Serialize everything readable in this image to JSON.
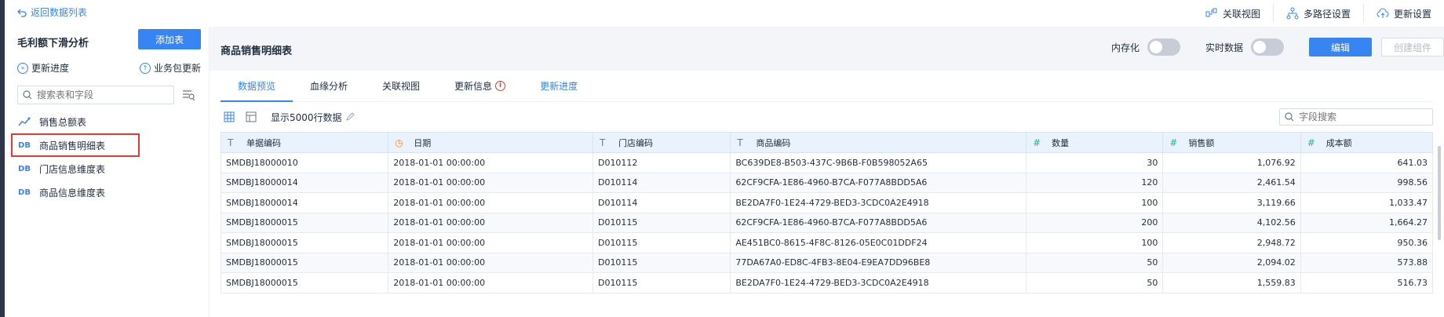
{
  "header": {
    "back_label": "返回数据列表",
    "actions": [
      {
        "label": "关联视图",
        "icon": "relation-view-icon"
      },
      {
        "label": "多路径设置",
        "icon": "multi-path-icon"
      },
      {
        "label": "更新设置",
        "icon": "cloud-update-icon"
      }
    ]
  },
  "sidebar": {
    "title": "毛利额下滑分析",
    "add_table_label": "添加表",
    "update_progress_label": "更新进度",
    "package_update_label": "业务包更新",
    "search_placeholder": "搜索表和字段",
    "items": [
      {
        "label": "销售总额表",
        "icon": "analysis-table-icon"
      },
      {
        "label": "商品销售明细表",
        "icon": "db-table-icon"
      },
      {
        "label": "门店信息维度表",
        "icon": "db-table-icon"
      },
      {
        "label": "商品信息维度表",
        "icon": "db-table-icon"
      }
    ]
  },
  "main": {
    "title": "商品销售明细表",
    "in_memory_label": "内存化",
    "realtime_label": "实时数据",
    "edit_label": "编辑",
    "create_component_label": "创建组件",
    "tabs": [
      {
        "label": "数据预览"
      },
      {
        "label": "血缘分析"
      },
      {
        "label": "关联视图"
      },
      {
        "label": "更新信息"
      },
      {
        "label": "更新进度"
      }
    ],
    "rows_label": "显示5000行数据",
    "field_search_placeholder": "字段搜索"
  },
  "table": {
    "columns": [
      {
        "label": "单据编码",
        "type": "T"
      },
      {
        "label": "日期",
        "type": "date"
      },
      {
        "label": "门店编码",
        "type": "T"
      },
      {
        "label": "商品编码",
        "type": "T"
      },
      {
        "label": "数量",
        "type": "#"
      },
      {
        "label": "销售额",
        "type": "#"
      },
      {
        "label": "成本额",
        "type": "#"
      }
    ],
    "rows": [
      [
        "SMDBJ18000010",
        "2018-01-01 00:00:00",
        "D010112",
        "BC639DE8-B503-437C-9B6B-F0B598052A65",
        "30",
        "1,076.92",
        "641.03"
      ],
      [
        "SMDBJ18000014",
        "2018-01-01 00:00:00",
        "D010114",
        "62CF9CFA-1E86-4960-B7CA-F077A8BDD5A6",
        "120",
        "2,461.54",
        "998.56"
      ],
      [
        "SMDBJ18000014",
        "2018-01-01 00:00:00",
        "D010114",
        "BE2DA7F0-1E24-4729-BED3-3CDC0A2E4918",
        "100",
        "3,119.66",
        "1,033.47"
      ],
      [
        "SMDBJ18000015",
        "2018-01-01 00:00:00",
        "D010115",
        "62CF9CFA-1E86-4960-B7CA-F077A8BDD5A6",
        "200",
        "4,102.56",
        "1,664.27"
      ],
      [
        "SMDBJ18000015",
        "2018-01-01 00:00:00",
        "D010115",
        "AE451BC0-8615-4F8C-8126-05E0C01DDF24",
        "100",
        "2,948.72",
        "950.36"
      ],
      [
        "SMDBJ18000015",
        "2018-01-01 00:00:00",
        "D010115",
        "77DA67A0-ED8C-4FB3-8E04-E9EA7DD96BE8",
        "50",
        "2,094.02",
        "573.88"
      ],
      [
        "SMDBJ18000015",
        "2018-01-01 00:00:00",
        "D010115",
        "BE2DA7F0-1E24-4729-BED3-3CDC0A2E4918",
        "50",
        "1,559.83",
        "516.73"
      ]
    ]
  },
  "colors": {
    "accent": "#3685f2",
    "highlight_border": "#e53935"
  }
}
